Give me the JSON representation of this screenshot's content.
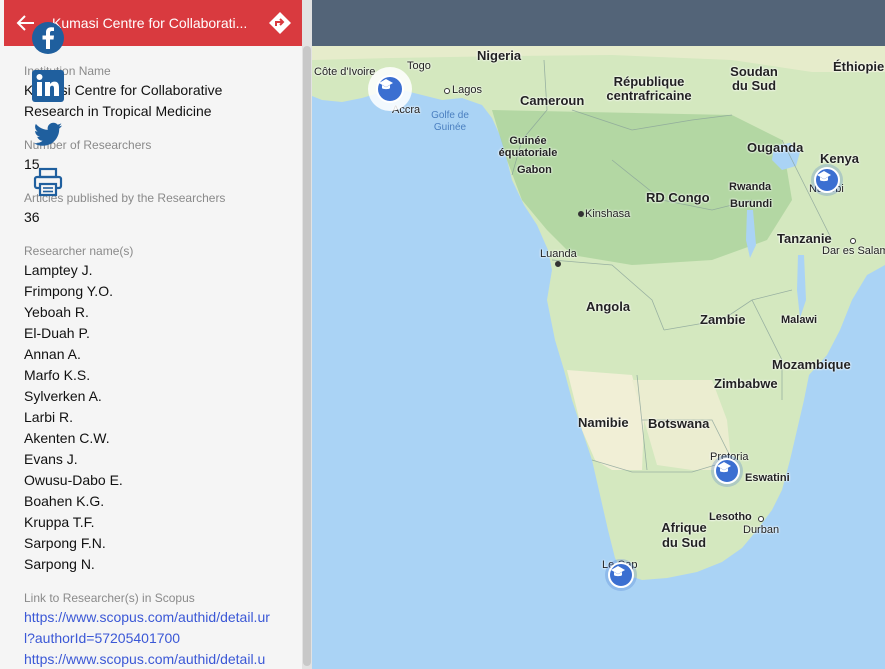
{
  "header": {
    "title": "Kumasi Centre for Collaborati..."
  },
  "panel": {
    "institution_label": "Institution Name",
    "institution_name": "Kumasi Centre for Collaborative Research in Tropical Medicine",
    "researchers_count_label": "Number of Researchers",
    "researchers_count": "15",
    "articles_label": "Articles published by the Researchers",
    "articles_count": "36",
    "researcher_names_label": "Researcher name(s)",
    "researchers": [
      "Lamptey J.",
      "Frimpong Y.O.",
      "Yeboah R.",
      "El-Duah P.",
      "Annan A.",
      "Marfo K.S.",
      "Sylverken A.",
      "Larbi R.",
      "Akenten C.W.",
      "Evans J.",
      "Owusu-Dabo E.",
      "Boahen K.G.",
      "Kruppa T.F.",
      "Sarpong F.N.",
      "Sarpong N."
    ],
    "links_label": "Link to Researcher(s) in Scopus",
    "links": [
      "https://www.scopus.com/authid/detail.url?authorId=57205401700",
      "https://www.scopus.com/authid/detail.u"
    ]
  },
  "social_icons": [
    "facebook-icon",
    "linkedin-icon",
    "twitter-icon",
    "print-icon"
  ],
  "map_labels": {
    "nigeria": "Nigeria",
    "soudan_sud": "Soudan du Sud",
    "ethiopie": "Éthiopie",
    "cote_ivoire": "Côte d'Ivoire",
    "togo": "Togo",
    "rep_centrafricaine": "République centrafricaine",
    "lagos": "Lagos",
    "accra": "Accra",
    "golfe_guinee": "Golfe de Guinée",
    "cameroun": "Cameroun",
    "guinee_eq": "Guinée équatoriale",
    "gabon": "Gabon",
    "ouganda": "Ouganda",
    "kenya": "Kenya",
    "rd_congo": "RD Congo",
    "rwanda": "Rwanda",
    "burundi": "Burundi",
    "nairobi": "Nairobi",
    "kinshasa": "Kinshasa",
    "tanzanie": "Tanzanie",
    "dar_es_salaam": "Dar es Salam",
    "luanda": "Luanda",
    "angola": "Angola",
    "zambie": "Zambie",
    "malawi": "Malawi",
    "mozambique": "Mozambique",
    "zimbabwe": "Zimbabwe",
    "namibie": "Namibie",
    "botswana": "Botswana",
    "pretoria": "Pretoria",
    "eswatini": "Eswatini",
    "lesotho": "Lesotho",
    "durban": "Durban",
    "afrique_du_sud": "Afrique du Sud",
    "le_cap": "Le Cap"
  },
  "colors": {
    "header": "#d93a3f",
    "sea": "#aad3f5",
    "land": "#d4e8bf",
    "marker": "#3b6fd1",
    "link": "#3b58d6"
  }
}
